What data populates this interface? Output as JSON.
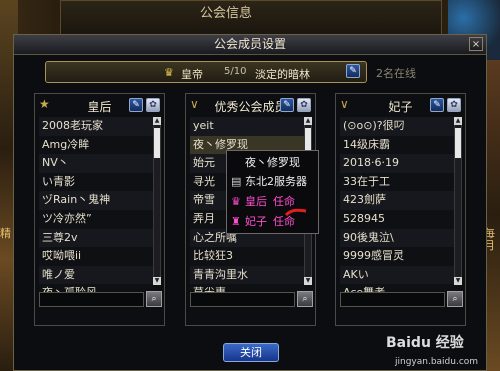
{
  "background": {
    "panel_title": "公会信息",
    "row_text": "淡定的暗林",
    "row_text2": "2名在线",
    "left_char": "精",
    "right_chars": "毎\n月"
  },
  "dialog": {
    "title": "公会成员设置",
    "close_glyph": "×",
    "leader": {
      "role": "皇帝",
      "count": "5/10",
      "name": "淡定的暗林"
    },
    "close_button": "关闭"
  },
  "panels": [
    {
      "title": "皇后",
      "icon": "star-icon",
      "members": [
        "2008老玩家",
        "Amg冷眸",
        "NV丶",
        "い青影",
        "ヅRain丶鬼神",
        "ツ冷亦然”",
        "三尊2v",
        "哎呦喂ii",
        "唯ノ爱",
        "夜丶孤聆风"
      ]
    },
    {
      "title": "优秀公会成员",
      "icon": "chevron-icon",
      "members": [
        "yeit",
        "夜丶修罗现",
        "始元",
        "寻光",
        "帝雪",
        "弄月",
        "心之所嘱",
        "比较狂3",
        "青青沟里水",
        "莫尜惠"
      ]
    },
    {
      "title": "妃子",
      "icon": "chevron-icon",
      "members": [
        "(⊙o⊙)?很叼",
        "14级床霸",
        "2018·6·19",
        "33在于工",
        "423劍萨",
        "528945",
        "90後鬼泣\\",
        "9999感冒灵",
        "AKい",
        "Ace舞者"
      ]
    }
  ],
  "context_menu": {
    "header": "夜丶修罗现",
    "server": "东北2服务器",
    "opt1_role": "皇后",
    "opt1_action": "任命",
    "opt2_role": "妃子",
    "opt2_action": "任命"
  },
  "watermark": {
    "brand": "Baidu 经验",
    "url": "jingyan.baidu.com"
  },
  "colors": {
    "accent_pink": "#ff4dd0",
    "button_blue": "#2c58a8"
  }
}
